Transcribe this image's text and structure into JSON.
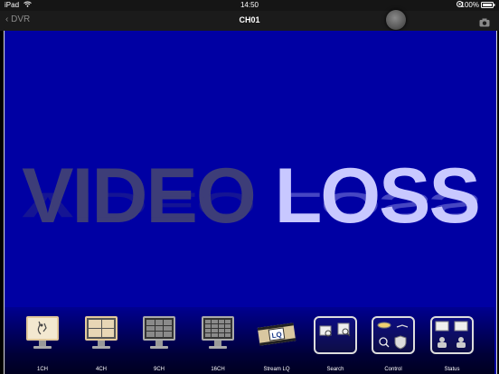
{
  "status": {
    "device": "iPad",
    "time": "14:50",
    "battery": "100%"
  },
  "nav": {
    "back_label": "DVR",
    "title": "CH01"
  },
  "video": {
    "word1": "VIDEO",
    "word2": "LOSS"
  },
  "toolbar": {
    "items": [
      {
        "label": "1CH",
        "icon": "single-channel-icon"
      },
      {
        "label": "4CH",
        "icon": "four-channel-icon"
      },
      {
        "label": "9CH",
        "icon": "nine-channel-icon"
      },
      {
        "label": "16CH",
        "icon": "sixteen-channel-icon"
      },
      {
        "label": "Stream LQ",
        "icon": "stream-lq-icon"
      },
      {
        "label": "Search",
        "icon": "search-icon"
      },
      {
        "label": "Control",
        "icon": "control-icon"
      },
      {
        "label": "Status",
        "icon": "status-icon"
      }
    ]
  },
  "colors": {
    "video_bg": "#0000a3",
    "accent_light": "#c8c8ff"
  }
}
